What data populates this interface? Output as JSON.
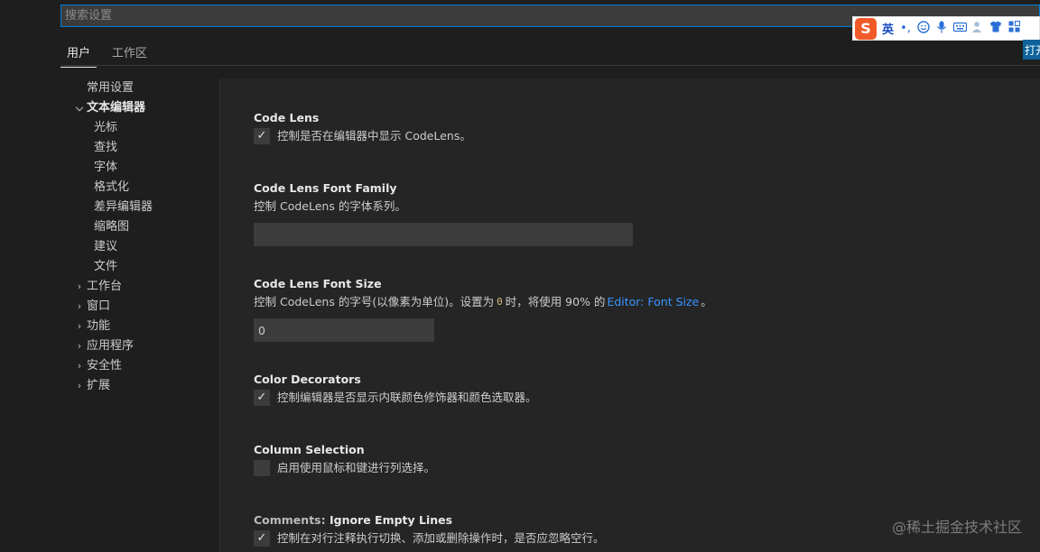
{
  "search": {
    "placeholder": "搜索设置"
  },
  "ime": {
    "logo": "S",
    "mode": "英",
    "punct": "•,",
    "open_label": "打开"
  },
  "tabs": [
    {
      "label": "用户"
    },
    {
      "label": "工作区"
    }
  ],
  "toc": [
    {
      "label": "常用设置"
    },
    {
      "label": "文本编辑器"
    },
    {
      "label": "光标"
    },
    {
      "label": "查找"
    },
    {
      "label": "字体"
    },
    {
      "label": "格式化"
    },
    {
      "label": "差异编辑器"
    },
    {
      "label": "缩略图"
    },
    {
      "label": "建议"
    },
    {
      "label": "文件"
    },
    {
      "label": "工作台"
    },
    {
      "label": "窗口"
    },
    {
      "label": "功能"
    },
    {
      "label": "应用程序"
    },
    {
      "label": "安全性"
    },
    {
      "label": "扩展"
    }
  ],
  "settings": {
    "code_lens": {
      "title": "Code Lens",
      "desc": "控制是否在编辑器中显示 CodeLens。",
      "checked": true
    },
    "code_lens_font_family": {
      "title": "Code Lens Font Family",
      "desc": "控制 CodeLens 的字体系列。",
      "value": ""
    },
    "code_lens_font_size": {
      "title": "Code Lens Font Size",
      "desc_a": "控制 CodeLens 的字号(以像素为单位)。设置为",
      "code": "0",
      "desc_b": "时，将使用 90% 的",
      "link": "Editor: Font Size",
      "desc_c": "。",
      "value": "0"
    },
    "color_decorators": {
      "title": "Color Decorators",
      "desc": "控制编辑器是否显示内联颜色修饰器和颜色选取器。",
      "checked": true
    },
    "column_selection": {
      "title": "Column Selection",
      "desc": "启用使用鼠标和键进行列选择。",
      "checked": false
    },
    "comments_ignore_empty_lines": {
      "category": "Comments: ",
      "title": "Ignore Empty Lines",
      "desc": "控制在对行注释执行切换、添加或删除操作时，是否应忽略空行。",
      "checked": true
    }
  },
  "watermark": "@稀土掘金技术社区",
  "colors": {
    "accent": "#007fd4",
    "link": "#3794ff",
    "code": "#d7ba7d",
    "ime_logo": "#f05a28"
  }
}
